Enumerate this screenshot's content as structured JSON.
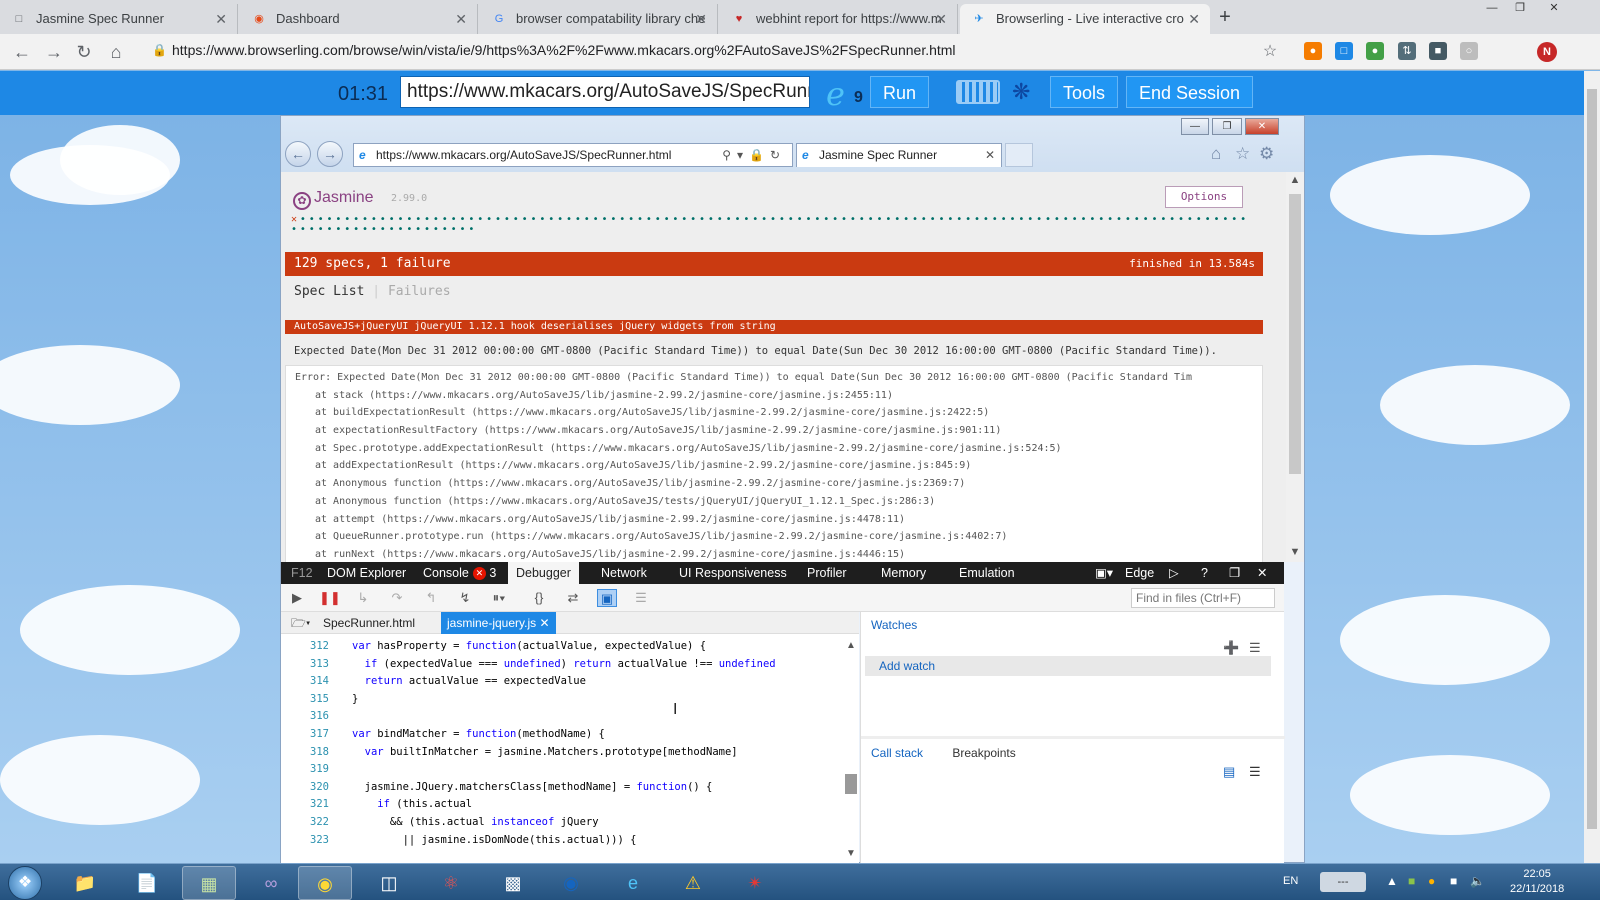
{
  "chrome": {
    "tabs": [
      {
        "title": "Jasmine Spec Runner",
        "icon": "page-icon",
        "active": false
      },
      {
        "title": "Dashboard",
        "icon": "dashboard-icon",
        "active": false
      },
      {
        "title": "browser compatability library che",
        "icon": "google-icon",
        "active": false
      },
      {
        "title": "webhint report for https://www.m",
        "icon": "webhint-icon",
        "active": false
      },
      {
        "title": "Browserling - Live interactive cro",
        "icon": "browserling-icon",
        "active": true
      }
    ],
    "url": "https://www.browserling.com/browse/win/vista/ie/9/https%3A%2F%2Fwww.mkacars.org%2FAutoSaveJS%2FSpecRunner.html",
    "profile_initial": "N"
  },
  "browserling": {
    "timer": "01:31",
    "url": "https://www.mkacars.org/AutoSaveJS/SpecRunner.html",
    "ie_version": "9",
    "run": "Run",
    "tools": "Tools",
    "end_session": "End Session"
  },
  "ie": {
    "address": "https://www.mkacars.org/AutoSaveJS/SpecRunner.html",
    "tab_title": "Jasmine Spec Runner"
  },
  "jasmine": {
    "name": "Jasmine",
    "version": "2.99.0",
    "options": "Options",
    "summary": "129 specs, 1 failure",
    "duration": "finished in 13.584s",
    "menu_spec_list": "Spec List",
    "menu_separator": "|",
    "menu_failures": "Failures",
    "failed_spec": "AutoSaveJS+jQueryUI jQueryUI 1.12.1 hook deserialises jQuery widgets from string",
    "expectation": "Expected Date(Mon Dec 31 2012 00:00:00 GMT-0800 (Pacific Standard Time)) to equal Date(Sun Dec 30 2012 16:00:00 GMT-0800 (Pacific Standard Time)).",
    "stack": [
      "Error: Expected Date(Mon Dec 31 2012 00:00:00 GMT-0800 (Pacific Standard Time)) to equal Date(Sun Dec 30 2012 16:00:00 GMT-0800 (Pacific Standard Tim",
      "at stack (https://www.mkacars.org/AutoSaveJS/lib/jasmine-2.99.2/jasmine-core/jasmine.js:2455:11)",
      "at buildExpectationResult (https://www.mkacars.org/AutoSaveJS/lib/jasmine-2.99.2/jasmine-core/jasmine.js:2422:5)",
      "at expectationResultFactory (https://www.mkacars.org/AutoSaveJS/lib/jasmine-2.99.2/jasmine-core/jasmine.js:901:11)",
      "at Spec.prototype.addExpectationResult (https://www.mkacars.org/AutoSaveJS/lib/jasmine-2.99.2/jasmine-core/jasmine.js:524:5)",
      "at addExpectationResult (https://www.mkacars.org/AutoSaveJS/lib/jasmine-2.99.2/jasmine-core/jasmine.js:845:9)",
      "at Anonymous function (https://www.mkacars.org/AutoSaveJS/lib/jasmine-2.99.2/jasmine-core/jasmine.js:2369:7)",
      "at Anonymous function (https://www.mkacars.org/AutoSaveJS/tests/jQueryUI/jQueryUI_1.12.1_Spec.js:286:3)",
      "at attempt (https://www.mkacars.org/AutoSaveJS/lib/jasmine-2.99.2/jasmine-core/jasmine.js:4478:11)",
      "at QueueRunner.prototype.run (https://www.mkacars.org/AutoSaveJS/lib/jasmine-2.99.2/jasmine-core/jasmine.js:4402:7)",
      "at runNext (https://www.mkacars.org/AutoSaveJS/lib/jasmine-2.99.2/jasmine-core/jasmine.js:4446:15)"
    ]
  },
  "devtools": {
    "tabs": [
      "F12",
      "DOM Explorer",
      "Console",
      "Debugger",
      "Network",
      "UI Responsiveness",
      "Profiler",
      "Memory",
      "Emulation"
    ],
    "console_errors": "3",
    "active_tab": "Debugger",
    "engine": "Edge",
    "help": "?",
    "find_placeholder": "Find in files (Ctrl+F)",
    "files": [
      "SpecRunner.html",
      "jasmine-jquery.js"
    ],
    "watches": "Watches",
    "add_watch": "Add watch",
    "call_stack": "Call stack",
    "breakpoints": "Breakpoints",
    "code": [
      {
        "ln": "312",
        "text": "var hasProperty = function(actualValue, expectedValue) {"
      },
      {
        "ln": "313",
        "text": "  if (expectedValue === undefined) return actualValue !== undefined"
      },
      {
        "ln": "314",
        "text": "  return actualValue == expectedValue"
      },
      {
        "ln": "315",
        "text": "}"
      },
      {
        "ln": "316",
        "text": ""
      },
      {
        "ln": "317",
        "text": "var bindMatcher = function(methodName) {"
      },
      {
        "ln": "318",
        "text": "  var builtInMatcher = jasmine.Matchers.prototype[methodName]"
      },
      {
        "ln": "319",
        "text": ""
      },
      {
        "ln": "320",
        "text": "  jasmine.JQuery.matchersClass[methodName] = function() {"
      },
      {
        "ln": "321",
        "text": "    if (this.actual"
      },
      {
        "ln": "322",
        "text": "      && (this.actual instanceof jQuery"
      },
      {
        "ln": "323",
        "text": "        || jasmine.isDomNode(this.actual))) {"
      }
    ]
  },
  "taskbar": {
    "language": "EN",
    "tray_box": "---",
    "time": "22:05",
    "date": "22/11/2018"
  }
}
